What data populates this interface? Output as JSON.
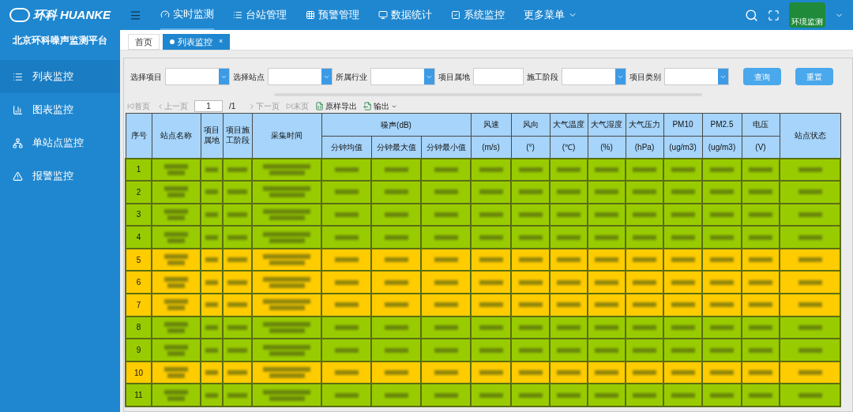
{
  "brand": {
    "logo_text": "环科",
    "logo_latin": "HUANKE",
    "platform": "北京环科噪声监测平台"
  },
  "sidebar": {
    "items": [
      {
        "label": "列表监控",
        "selected": true
      },
      {
        "label": "图表监控",
        "selected": false
      },
      {
        "label": "单站点监控",
        "selected": false
      },
      {
        "label": "报警监控",
        "selected": false
      }
    ]
  },
  "topnav": {
    "items": [
      {
        "label": "实时监测",
        "kind": "link",
        "selected": true
      },
      {
        "label": "台站管理",
        "kind": "link",
        "selected": false
      },
      {
        "label": "预警管理",
        "kind": "link",
        "selected": false
      },
      {
        "label": "数据统计",
        "kind": "link",
        "selected": false
      },
      {
        "label": "系统监控",
        "kind": "link",
        "selected": false
      },
      {
        "label": "更多菜单",
        "kind": "dropdown",
        "selected": false
      }
    ],
    "avatar_label": "环境监测"
  },
  "tabs": [
    {
      "label": "首页",
      "selected": false
    },
    {
      "label": "列表监控",
      "selected": true,
      "close": "×"
    }
  ],
  "filters": [
    {
      "label": "选择项目",
      "kind": "select"
    },
    {
      "label": "选择站点",
      "kind": "select"
    },
    {
      "label": "所属行业",
      "kind": "select"
    },
    {
      "label": "项目属地",
      "kind": "text"
    },
    {
      "label": "施工阶段",
      "kind": "select"
    },
    {
      "label": "项目类别",
      "kind": "select"
    }
  ],
  "buttons": [
    "查询",
    "重置"
  ],
  "pager": {
    "first": "首页",
    "prev": "上一页",
    "page": "1",
    "total": "/1",
    "next": "下一页",
    "last": "末页",
    "export_raw": "原样导出",
    "export": "输出"
  },
  "table": {
    "columns": [
      {
        "label": "序号"
      },
      {
        "label": "站点名称"
      },
      {
        "label": "项目属地"
      },
      {
        "label": "项目施工阶段"
      },
      {
        "label": "采集时间"
      },
      {
        "label": "噪声(dB)",
        "children": [
          "分钟均值",
          "分钟最大值",
          "分钟最小值"
        ]
      },
      {
        "label": "风速",
        "unit": "(m/s)"
      },
      {
        "label": "风向",
        "unit": "(°)"
      },
      {
        "label": "大气温度",
        "unit": "(℃)"
      },
      {
        "label": "大气湿度",
        "unit": "(%)"
      },
      {
        "label": "大气压力",
        "unit": "(hPa)"
      },
      {
        "label": "PM10",
        "unit": "(ug/m3)"
      },
      {
        "label": "PM2.5",
        "unit": "(ug/m3)"
      },
      {
        "label": "电压",
        "unit": "(V)"
      },
      {
        "label": "站点状态"
      }
    ],
    "rows": [
      {
        "no": "1",
        "color": "#99cc00"
      },
      {
        "no": "2",
        "color": "#99cc00"
      },
      {
        "no": "3",
        "color": "#99cc00"
      },
      {
        "no": "4",
        "color": "#99cc00"
      },
      {
        "no": "5",
        "color": "#ffcc00"
      },
      {
        "no": "6",
        "color": "#ffcc00"
      },
      {
        "no": "7",
        "color": "#ffcc00"
      },
      {
        "no": "8",
        "color": "#99cc00"
      },
      {
        "no": "9",
        "color": "#99cc00"
      },
      {
        "no": "10",
        "color": "#ffcc00"
      },
      {
        "no": "11",
        "color": "#99cc00"
      }
    ]
  }
}
